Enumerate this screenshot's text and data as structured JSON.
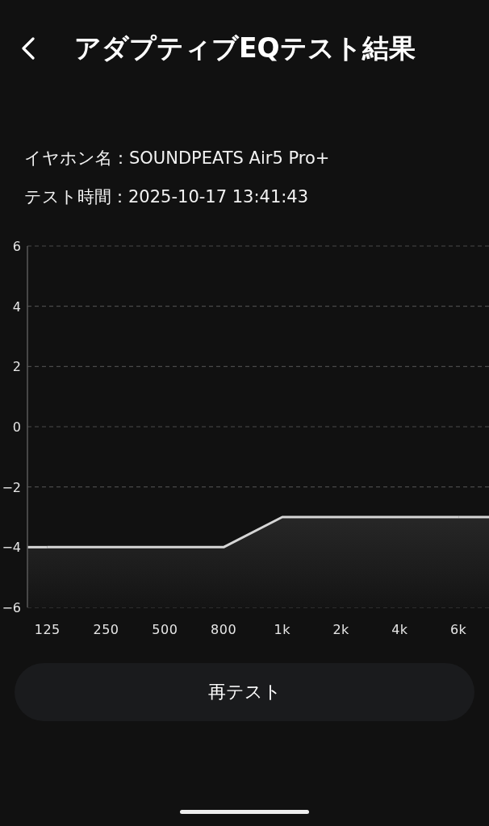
{
  "header": {
    "title": "アダプティブEQテスト結果"
  },
  "info_lines": [
    "イヤホン名：SOUNDPEATS Air5 Pro+",
    "テスト時間：2025-10-17 13:41:43"
  ],
  "chart": {
    "chart_data": {
      "type": "line",
      "categories": [
        "125",
        "250",
        "500",
        "800",
        "1k",
        "2k",
        "4k",
        "6k"
      ],
      "series": [
        {
          "color": "#d6d6d6",
          "values": [
            -4,
            -4,
            -4,
            -4,
            -3,
            -3,
            -3,
            -3
          ]
        }
      ],
      "ylim": [
        -6,
        6
      ],
      "yticks": [
        6,
        4,
        2,
        0,
        {
          "value": -2,
          "label": "−2"
        },
        {
          "value": -4,
          "label": "−4"
        },
        {
          "value": -6,
          "label": "−6"
        }
      ],
      "grid": true
    }
  },
  "retest_button": {
    "label": "再テスト"
  }
}
